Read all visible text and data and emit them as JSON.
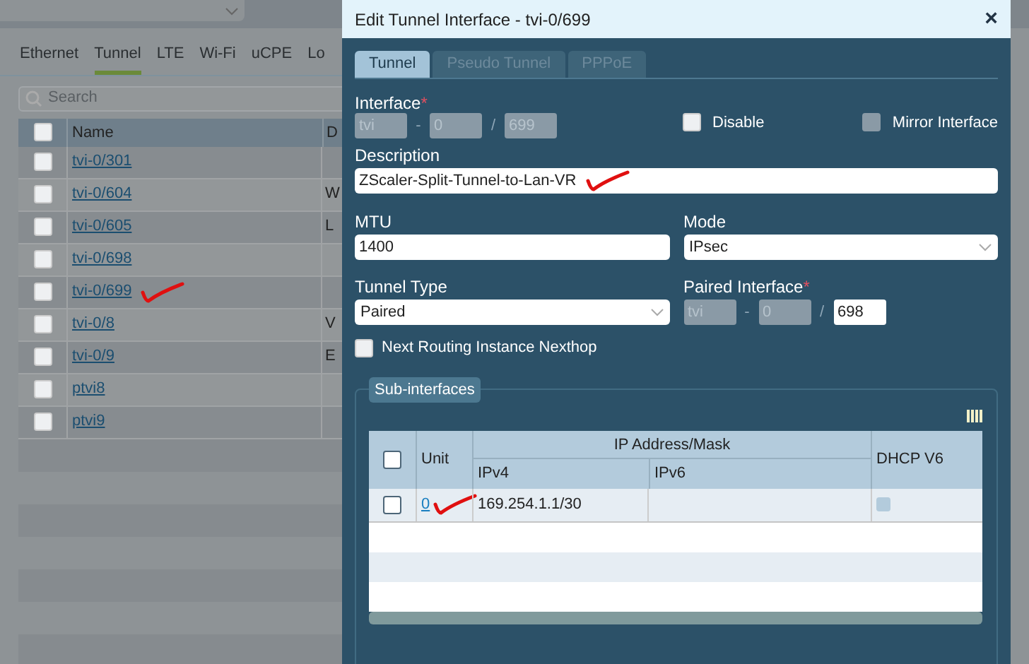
{
  "background": {
    "tabs": [
      {
        "label": "Ethernet",
        "selected": false
      },
      {
        "label": "Tunnel",
        "selected": true
      },
      {
        "label": "LTE",
        "selected": false
      },
      {
        "label": "Wi-Fi",
        "selected": false
      },
      {
        "label": "uCPE",
        "selected": false
      },
      {
        "label": "Lo",
        "selected": false
      }
    ],
    "search": {
      "placeholder": "Search"
    },
    "table": {
      "columns": [
        "Name",
        "D"
      ],
      "select_all_checked": false,
      "rows": [
        {
          "name": "tvi-0/301",
          "checked": false,
          "marked": false
        },
        {
          "name": "tvi-0/604",
          "column_2": "W",
          "checked": false,
          "marked": false
        },
        {
          "name": "tvi-0/605",
          "column_2": "L",
          "checked": false,
          "marked": false
        },
        {
          "name": "tvi-0/698",
          "checked": false,
          "marked": false
        },
        {
          "name": "tvi-0/699",
          "checked": false,
          "marked": true
        },
        {
          "name": "tvi-0/8",
          "column_2": "V",
          "checked": false,
          "marked": false
        },
        {
          "name": "tvi-0/9",
          "column_2": "E",
          "checked": false,
          "marked": false
        },
        {
          "name": "ptvi8",
          "checked": false,
          "marked": false
        },
        {
          "name": "ptvi9",
          "checked": false,
          "marked": false
        }
      ]
    }
  },
  "dialog": {
    "title": "Edit Tunnel Interface - tvi-0/699",
    "close": "×",
    "tabs": [
      {
        "label": "Tunnel",
        "selected": true
      },
      {
        "label": "Pseudo Tunnel",
        "selected": false
      },
      {
        "label": "PPPoE",
        "selected": false
      }
    ],
    "interface": {
      "label": "Interface",
      "required_mark": "*",
      "parts": [
        {
          "value": "tvi",
          "disabled": true
        },
        {
          "separator": "-",
          "value": "0",
          "disabled": true
        },
        {
          "separator": "/",
          "value": "699",
          "disabled": true
        }
      ]
    },
    "disable": {
      "label": "Disable",
      "checked": false,
      "disabled": false
    },
    "mirror_interface": {
      "label": "Mirror Interface",
      "checked": false,
      "disabled": true
    },
    "description": {
      "label": "Description",
      "value": "ZScaler-Split-Tunnel-to-Lan-VR",
      "marked": true
    },
    "mtu": {
      "label": "MTU",
      "value": "1400"
    },
    "mode": {
      "label": "Mode",
      "value": "IPsec"
    },
    "tunnel_type": {
      "label": "Tunnel Type",
      "value": "Paired"
    },
    "paired_interface": {
      "label": "Paired Interface",
      "required_mark": "*",
      "parts": [
        {
          "value": "tvi",
          "disabled": true
        },
        {
          "separator": "-",
          "value": "0",
          "disabled": true
        },
        {
          "separator": "/",
          "value": "698",
          "disabled": false
        }
      ]
    },
    "next_routing": {
      "label": "Next Routing Instance Nexthop",
      "checked": false,
      "disabled": false
    },
    "sub_interfaces": {
      "legend": "Sub-interfaces",
      "group_header": "IP Address/Mask",
      "select_all_checked": false,
      "columns": [
        "Unit",
        "IPv4",
        "IPv6",
        "DHCP V6"
      ],
      "rows": [
        {
          "unit": "0",
          "ipv4": "169.254.1.1/30",
          "checked": false,
          "dhcp_v6": false,
          "marked": true
        }
      ]
    }
  }
}
